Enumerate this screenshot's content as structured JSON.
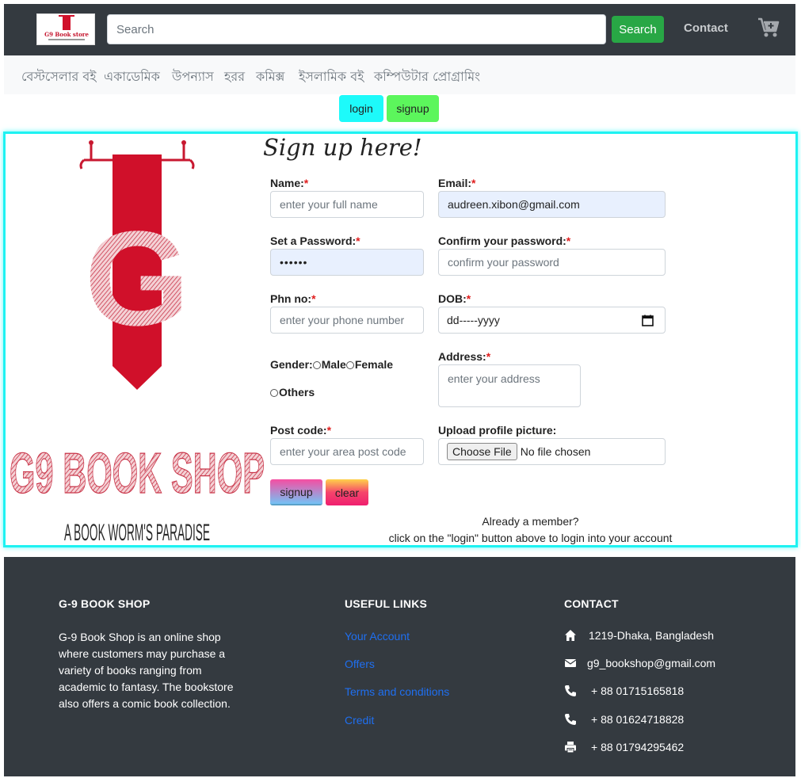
{
  "header": {
    "logo_text": "G9 Book store",
    "search_placeholder": "Search",
    "search_button": "Search",
    "contact_link": "Contact",
    "cart_icon": "cart-plus-icon"
  },
  "categories": [
    "বেস্টসেলার বই",
    "একাডেমিক",
    "উপন্যাস",
    "হরর",
    "কমিক্স",
    "ইসলামিক বই",
    "কম্পিউটার প্রোগ্রামিং"
  ],
  "auth": {
    "login_label": "login",
    "signup_label": "signup"
  },
  "brand": {
    "letter": "G",
    "name": "G9 BOOK SHOP",
    "tagline": "A BOOK WORM'S PARADISE"
  },
  "form": {
    "title": "Sign up here!",
    "required_mark": "*",
    "name_label": "Name:",
    "name_placeholder": "enter your full name",
    "email_label": "Email:",
    "email_value": "audreen.xibon@gmail.com",
    "password_label": "Set a Password:",
    "password_value": "••••••",
    "confirm_label": "Confirm your password:",
    "confirm_placeholder": "confirm your password",
    "phone_label": "Phn no:",
    "phone_placeholder": "enter your phone number",
    "dob_label": "DOB:",
    "dob_placeholder": "dd-----yyyy",
    "gender_label": "Gender:",
    "gender_male": "Male",
    "gender_female": "Female",
    "gender_others": "Others",
    "address_label": "Address:",
    "address_placeholder": "enter your address",
    "postcode_label": "Post code:",
    "postcode_placeholder": "enter your area post code",
    "upload_label": "Upload profile picture:",
    "choose_file": "Choose File",
    "no_file": "No file chosen",
    "signup_button": "signup",
    "clear_button": "clear",
    "member_line1": "Already a member?",
    "member_line2": "click on the \"login\" button above to login into your account"
  },
  "footer": {
    "about_heading": "G-9 BOOK SHOP",
    "about_text": "G-9 Book Shop is an online shop where customers may purchase a variety of books ranging from academic to fantasy. The bookstore also offers a comic book collection.",
    "links_heading": "USEFUL LINKS",
    "links": [
      "Your Account",
      "Offers",
      "Terms and conditions",
      "Credit"
    ],
    "contact_heading": "CONTACT",
    "address": "1219-Dhaka, Bangladesh",
    "email": "g9_bookshop@gmail.com",
    "phone1": "+ 88 01715165818",
    "phone2": "+ 88 01624718828",
    "fax": "+ 88 01794295462"
  },
  "colors": {
    "navbar": "#343a40",
    "search_button": "#28a745",
    "login_button": "#1dfafa",
    "signup_button": "#5cf65c",
    "card_border": "#1ef2f2",
    "brand_red": "#d0102a",
    "footer_link": "#1f6ff0"
  }
}
